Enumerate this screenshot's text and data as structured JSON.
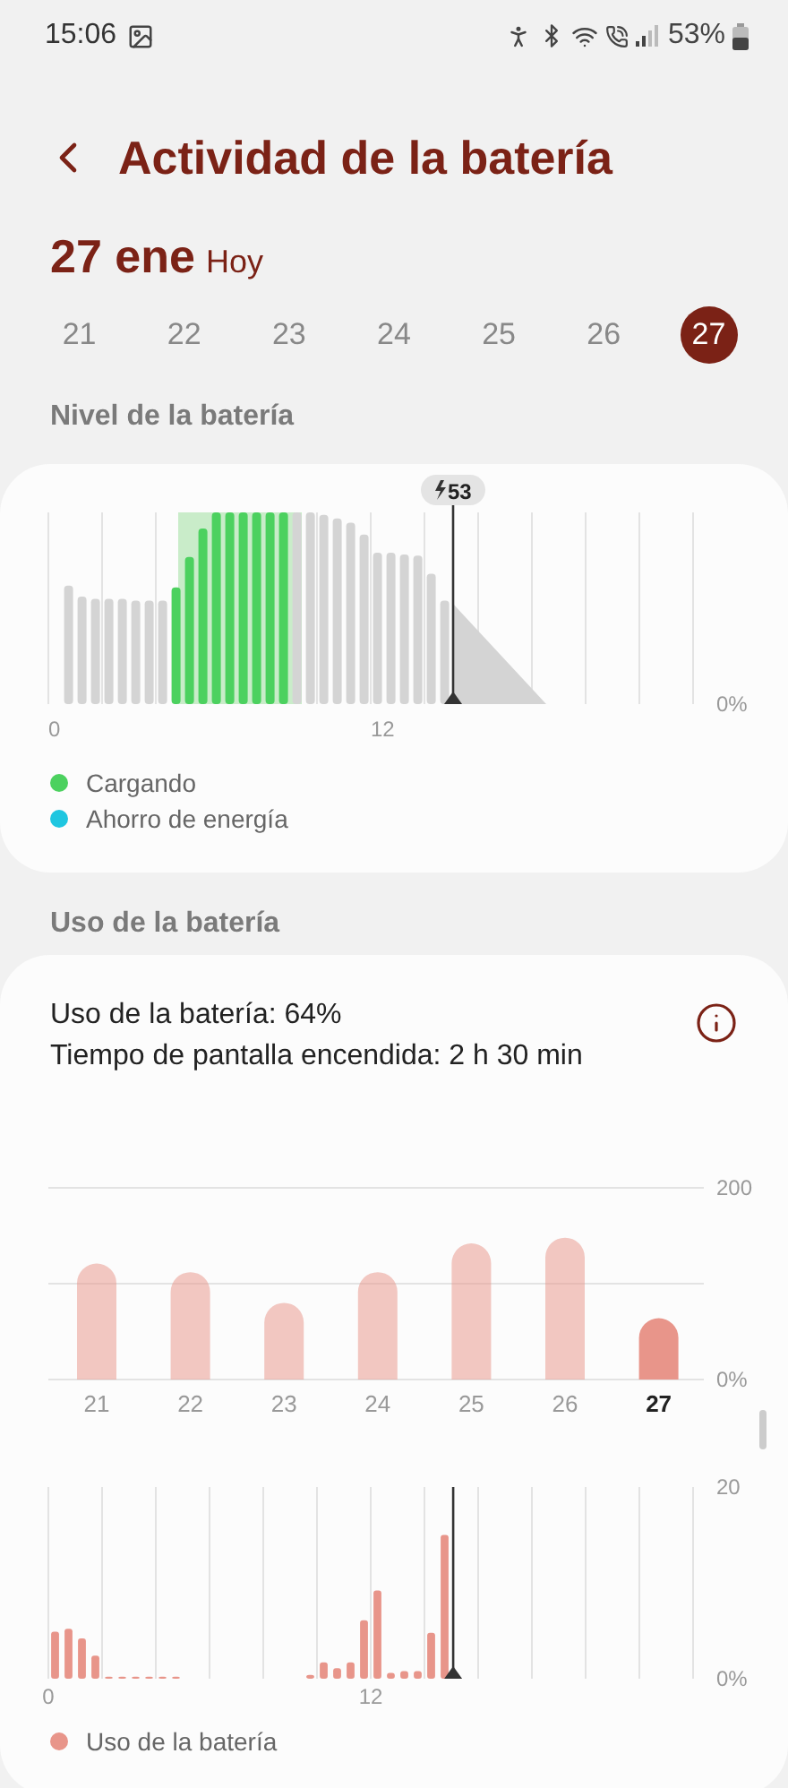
{
  "status_bar": {
    "time": "15:06",
    "battery": "53%"
  },
  "header": {
    "title": "Actividad de la batería"
  },
  "date": {
    "day": "27 ene",
    "label": "Hoy"
  },
  "days": [
    {
      "label": "21",
      "selected": false
    },
    {
      "label": "22",
      "selected": false
    },
    {
      "label": "23",
      "selected": false
    },
    {
      "label": "24",
      "selected": false
    },
    {
      "label": "25",
      "selected": false
    },
    {
      "label": "26",
      "selected": false
    },
    {
      "label": "27",
      "selected": true
    }
  ],
  "battery_level": {
    "title": "Nivel de la batería",
    "marker": "53",
    "x_labels": [
      "0",
      "12"
    ],
    "y_label": "0%",
    "legend": [
      {
        "label": "Cargando",
        "color": "#4cd15f"
      },
      {
        "label": "Ahorro de energía",
        "color": "#1fc6e0"
      }
    ]
  },
  "battery_usage": {
    "title": "Uso de la batería",
    "summary": [
      "Uso de la batería: 64%",
      "Tiempo de pantalla encendida: 2 h 30 min"
    ],
    "weekly": {
      "chart_data": {
        "type": "bar",
        "ref_lines": [
          {
            "axis": "y",
            "value": 100
          }
        ],
        "categories": [
          "21",
          "22",
          "23",
          "24",
          "25",
          "26",
          "27"
        ],
        "ylim": [
          0,
          200
        ],
        "yticks": [
          {
            "value": 0,
            "label": "0%"
          },
          {
            "value": 200,
            "label": "200"
          }
        ],
        "series": [
          {
            "color": "#e8958a",
            "values": [
              121,
              112,
              80,
              112,
              142,
              148,
              64
            ]
          }
        ]
      }
    },
    "hourly": {
      "chart_data": {
        "type": "bar",
        "xlim": [
          0,
          24
        ],
        "ylim": [
          0,
          20
        ],
        "ref_lines": [
          {
            "axis": "x",
            "value": 15.07
          }
        ],
        "xticks": [
          {
            "value": 0,
            "label": "0"
          },
          {
            "value": 12,
            "label": "12"
          }
        ],
        "yticks": [
          {
            "value": 0,
            "label": "0%"
          },
          {
            "value": 20,
            "label": "20"
          }
        ],
        "x": [
          0.25,
          0.75,
          1.25,
          1.75,
          2.25,
          2.75,
          3.25,
          3.75,
          4.25,
          4.75,
          9.75,
          10.25,
          10.75,
          11.25,
          11.75,
          12.25,
          12.75,
          13.25,
          13.75,
          14.25,
          14.75
        ],
        "series": [
          {
            "name": "Uso de la batería",
            "color": "#e8958a",
            "values": [
              4.9,
              5.2,
              4.2,
              2.4,
              0.2,
              0.2,
              0.2,
              0.2,
              0.2,
              0.2,
              0.4,
              1.7,
              1.1,
              1.7,
              6.1,
              9.2,
              0.6,
              0.8,
              0.8,
              4.8,
              15.0
            ]
          }
        ]
      }
    }
  }
}
